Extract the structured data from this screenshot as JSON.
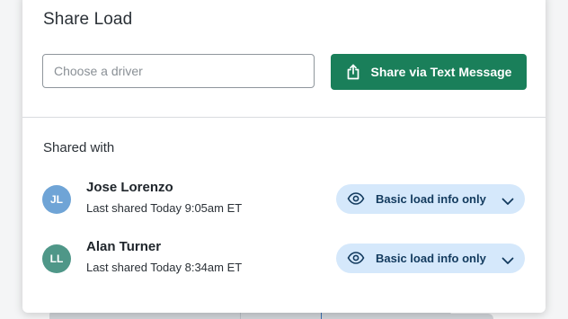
{
  "dialog": {
    "title": "Share Load",
    "driver_input": {
      "placeholder": "Choose a driver",
      "value": ""
    },
    "share_button_label": "Share via Text Message",
    "shared_with_label": "Shared with"
  },
  "shares": [
    {
      "initials": "JL",
      "avatar_color": "#6fa4d6",
      "name": "Jose Lorenzo",
      "last_shared": "Last shared Today 9:05am ET",
      "permission": "Basic load info only"
    },
    {
      "initials": "LL",
      "avatar_color": "#4f9788",
      "name": "Alan Turner",
      "last_shared": "Last shared Today 8:34am ET",
      "permission": "Basic load info only"
    }
  ],
  "colors": {
    "primary_button": "#1a7f5a",
    "permission_pill": "#d5e8fb",
    "permission_text": "#123a5e"
  },
  "icons": {
    "share_button": "share-upload-icon",
    "permission": "eye-icon",
    "dropdown": "chevron-down-icon"
  }
}
